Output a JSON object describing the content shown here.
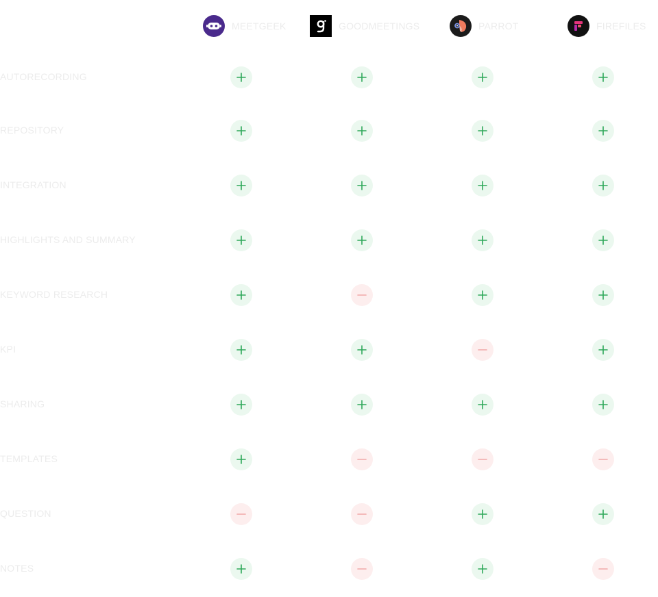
{
  "tools": [
    {
      "name": "MEETGEEK",
      "icon": "meetgeek-robot-icon"
    },
    {
      "name": "GOODMEETINGS",
      "icon": "goodmeetings-g-icon"
    },
    {
      "name": "PARROT",
      "icon": "parrot-bird-icon"
    },
    {
      "name": "FIREFILES",
      "icon": "fireflies-logo-icon"
    }
  ],
  "features": [
    {
      "label": "AUTORECORDING",
      "support": [
        true,
        true,
        true,
        true
      ]
    },
    {
      "label": "REPOSITORY",
      "support": [
        true,
        true,
        true,
        true
      ]
    },
    {
      "label": "INTEGRATION",
      "support": [
        true,
        true,
        true,
        true
      ]
    },
    {
      "label": "HIGHLIGHTS AND SUMMARY",
      "support": [
        true,
        true,
        true,
        true
      ]
    },
    {
      "label": "KEYWORD RESEARCH",
      "support": [
        true,
        false,
        true,
        true
      ]
    },
    {
      "label": "KPI",
      "support": [
        true,
        true,
        false,
        true
      ]
    },
    {
      "label": "SHARING",
      "support": [
        true,
        true,
        true,
        true
      ]
    },
    {
      "label": "TEMPLATES",
      "support": [
        true,
        false,
        false,
        false
      ]
    },
    {
      "label": "QUESTION",
      "support": [
        false,
        false,
        true,
        true
      ]
    },
    {
      "label": "NOTES",
      "support": [
        true,
        false,
        true,
        false
      ]
    }
  ],
  "colors": {
    "yes_bg": "#ebf8ef",
    "yes_fg": "#2fa85a",
    "no_bg": "#fdeeee",
    "no_fg": "#f2a8a8",
    "label_text": "#ececec",
    "meetgeek_brand": "#4a2a8c",
    "goodmeetings_brand": "#000000",
    "parrot_brand": "#1b1b1b",
    "fireflies_brand": "#111111"
  }
}
